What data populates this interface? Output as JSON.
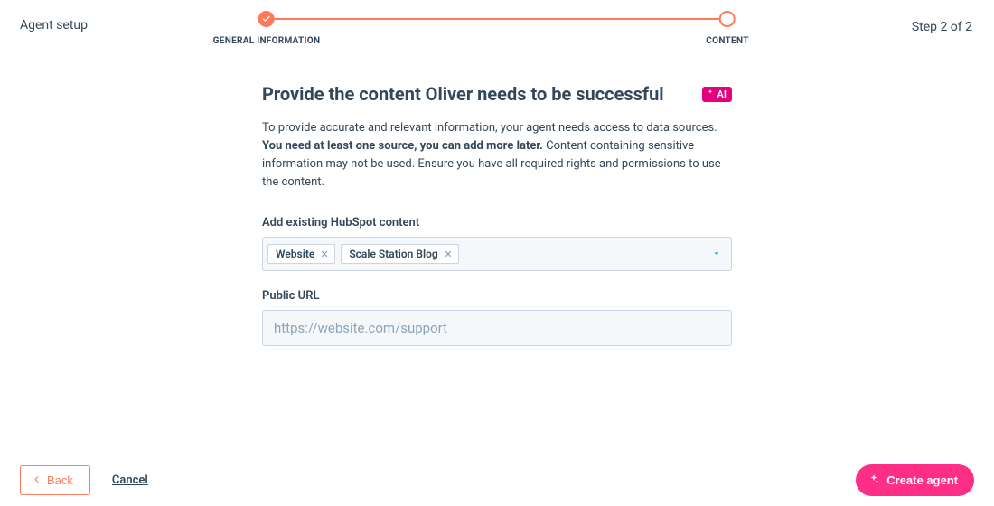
{
  "header": {
    "page_label": "Agent setup",
    "step_indicator": "Step 2 of 2"
  },
  "stepper": {
    "step1": {
      "label": "GENERAL INFORMATION",
      "state": "done"
    },
    "step2": {
      "label": "CONTENT",
      "state": "current"
    }
  },
  "main": {
    "title": "Provide the content Oliver needs to be successful",
    "ai_badge": "AI",
    "description_pre": "To provide accurate and relevant information, your agent needs access to data sources. ",
    "description_bold": "You need at least one source, you can add more later.",
    "description_post": " Content containing sensitive information may not be used. Ensure you have all required rights and permissions to use the content."
  },
  "fields": {
    "existing_content": {
      "label": "Add existing HubSpot content",
      "selected": [
        {
          "label": "Website"
        },
        {
          "label": "Scale Station Blog"
        }
      ]
    },
    "public_url": {
      "label": "Public URL",
      "placeholder": "https://website.com/support",
      "value": ""
    }
  },
  "footer": {
    "back": "Back",
    "cancel": "Cancel",
    "create": "Create agent"
  }
}
